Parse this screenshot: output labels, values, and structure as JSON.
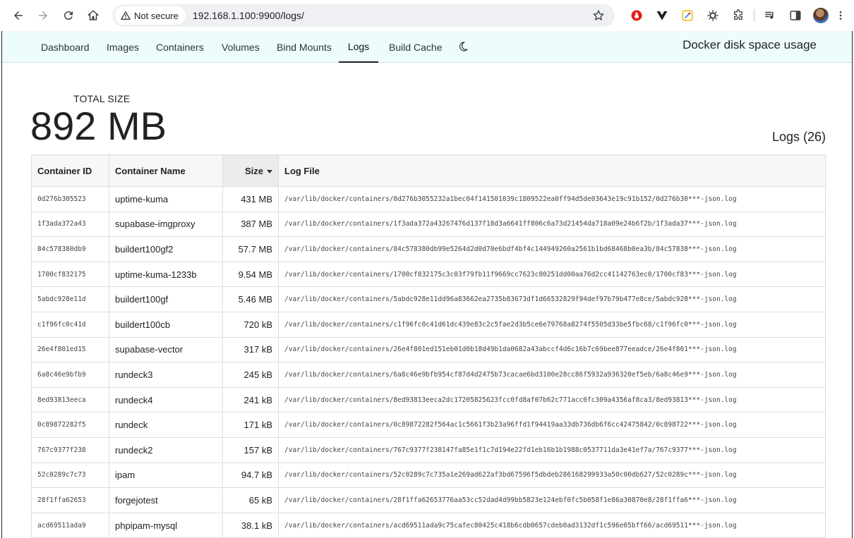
{
  "browser": {
    "security_label": "Not secure",
    "url": "192.168.1.100:9900/logs/"
  },
  "nav": {
    "tabs": [
      "Dashboard",
      "Images",
      "Containers",
      "Volumes",
      "Bind Mounts",
      "Logs",
      "Build Cache"
    ],
    "active_tab": "Logs",
    "app_title": "Docker disk space usage"
  },
  "summary": {
    "total_label": "TOTAL SIZE",
    "total_value": "892 MB",
    "logs_count": "Logs (26)"
  },
  "table": {
    "headers": {
      "container_id": "Container ID",
      "container_name": "Container Name",
      "size": "Size",
      "log_file": "Log File"
    },
    "rows": [
      {
        "id": "0d276b305523",
        "name": "uptime-kuma",
        "size": "431 MB",
        "log": "/var/lib/docker/containers/0d276b3055232a1bec04f141501039c1809522ea0ff94d5de03643e19c91b152/0d276b30***-json.log"
      },
      {
        "id": "1f3ada372a43",
        "name": "supabase-imgproxy",
        "size": "387 MB",
        "log": "/var/lib/docker/containers/1f3ada372a43267476d137f18d3a6641ff806c6a73d21454da718a09e24b6f2b/1f3ada37***-json.log"
      },
      {
        "id": "84c578380db9",
        "name": "buildert100gf2",
        "size": "57.7 MB",
        "log": "/var/lib/docker/containers/84c578380db99e5264d2d0d70e6bdf4bf4c144949260a2561b1bd68468b0ea3b/84c57838***-json.log"
      },
      {
        "id": "1700cf832175",
        "name": "uptime-kuma-1233b",
        "size": "9.54 MB",
        "log": "/var/lib/docker/containers/1700cf832175c3c03f79fb11f9669cc7623c80251dd00aa76d2cc41142763ec0/1700cf83***-json.log"
      },
      {
        "id": "5abdc928e11d",
        "name": "buildert100gf",
        "size": "5.46 MB",
        "log": "/var/lib/docker/containers/5abdc928e11dd96a83662ea2735b83673df1d66532829f94def97b79b477e8ce/5abdc928***-json.log"
      },
      {
        "id": "c1f96fc0c41d",
        "name": "buildert100cb",
        "size": "720 kB",
        "log": "/var/lib/docker/containers/c1f96fc0c41d61dc439e83c2c5fae2d3b5ce6e79768a8274f5505d33be5fbc68/c1f96fc0***-json.log"
      },
      {
        "id": "26e4f801ed15",
        "name": "supabase-vector",
        "size": "317 kB",
        "log": "/var/lib/docker/containers/26e4f801ed151eb01d0b18d49b1da0682a43abccf4d6c16b7c69bee877eeadce/26e4f801***-json.log"
      },
      {
        "id": "6a8c46e9bfb9",
        "name": "rundeck3",
        "size": "245 kB",
        "log": "/var/lib/docker/containers/6a8c46e9bfb954cf87d4d2475b73cacae6bd3100e28cc86f5932a936320ef5eb/6a8c46e9***-json.log"
      },
      {
        "id": "8ed93813eeca",
        "name": "rundeck4",
        "size": "241 kB",
        "log": "/var/lib/docker/containers/8ed93813eeca2dc17205825623fcc0fd8af07b62c771acc0fc309a4356af8ca3/8ed93813***-json.log"
      },
      {
        "id": "0c89872282f5",
        "name": "rundeck",
        "size": "171 kB",
        "log": "/var/lib/docker/containers/0c89872282f564ac1c5661f3b23a96ffd1f94419aa33db736db6f6cc42475842/0c898722***-json.log"
      },
      {
        "id": "767c9377f238",
        "name": "rundeck2",
        "size": "157 kB",
        "log": "/var/lib/docker/containers/767c9377f238147fa85e1f1c7d194e22fd1eb16b1b1988c0537711da3e41ef7a/767c9377***-json.log"
      },
      {
        "id": "52c0289c7c73",
        "name": "ipam",
        "size": "94.7 kB",
        "log": "/var/lib/docker/containers/52c0289c7c735a1e269ad622af3bd67596f5dbdeb286168299933a50c00db627/52c0289c***-json.log"
      },
      {
        "id": "28f1ffa62653",
        "name": "forgejotest",
        "size": "65 kB",
        "log": "/var/lib/docker/containers/28f1ffa62653776aa53cc52dad4d99bb5823e124ebf0fc5b058f1e86a30870e8/28f1ffa6***-json.log"
      },
      {
        "id": "acd69511ada9",
        "name": "phpipam-mysql",
        "size": "38.1 kB",
        "log": "/var/lib/docker/containers/acd69511ada9c75cafec80425c418b6cdb0657cdeb0ad3132df1c596e05bff66/acd69511***-json.log"
      }
    ]
  }
}
